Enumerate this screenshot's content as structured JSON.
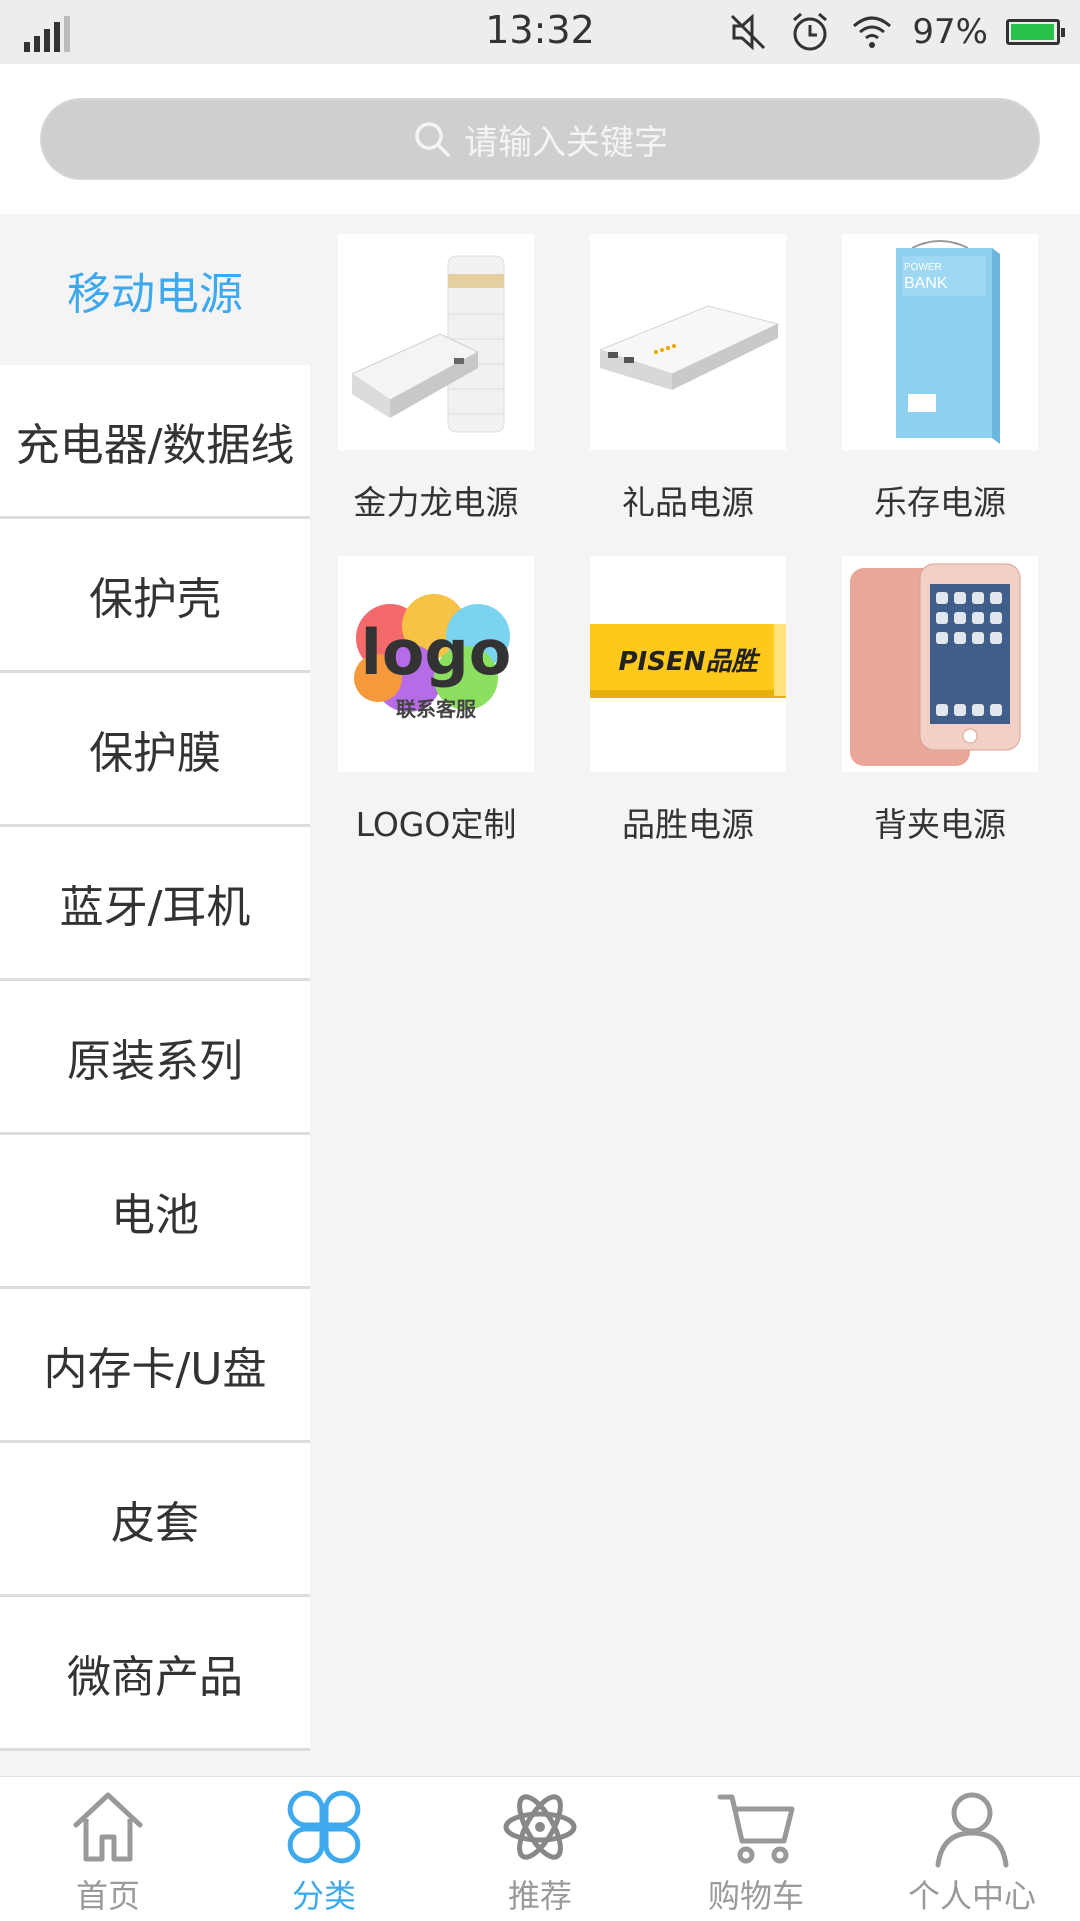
{
  "status_bar": {
    "time": "13:32",
    "battery_percent": "97%",
    "battery_level": 0.97,
    "icons": [
      "signal-icon",
      "mute-icon",
      "alarm-icon",
      "wifi-icon",
      "battery-icon"
    ]
  },
  "search": {
    "placeholder": "请输入关键字"
  },
  "sidebar": {
    "items": [
      {
        "label": "移动电源",
        "active": true
      },
      {
        "label": "充电器/数据线",
        "active": false
      },
      {
        "label": "保护壳",
        "active": false
      },
      {
        "label": "保护膜",
        "active": false
      },
      {
        "label": "蓝牙/耳机",
        "active": false
      },
      {
        "label": "原装系列",
        "active": false
      },
      {
        "label": "电池",
        "active": false
      },
      {
        "label": "内存卡/U盘",
        "active": false
      },
      {
        "label": "皮套",
        "active": false
      },
      {
        "label": "微商产品",
        "active": false
      }
    ]
  },
  "products": [
    {
      "name": "金力龙电源",
      "image": "white-striped-power-bank"
    },
    {
      "name": "礼品电源",
      "image": "white-rounded-power-bank"
    },
    {
      "name": "乐存电源",
      "image": "blue-power-bank-box"
    },
    {
      "name": "LOGO定制",
      "image": "colorful-logo-badge",
      "image_text": [
        "logo",
        "联系客服"
      ]
    },
    {
      "name": "品胜电源",
      "image": "pisen-yellow-power-bank",
      "image_text": [
        "PISEN品胜"
      ]
    },
    {
      "name": "背夹电源",
      "image": "rose-gold-phone-battery-case"
    }
  ],
  "tabbar": {
    "tabs": [
      {
        "label": "首页",
        "icon": "home-icon",
        "active": false
      },
      {
        "label": "分类",
        "icon": "category-icon",
        "active": true
      },
      {
        "label": "推荐",
        "icon": "atom-icon",
        "active": false
      },
      {
        "label": "购物车",
        "icon": "cart-icon",
        "active": false
      },
      {
        "label": "个人中心",
        "icon": "person-icon",
        "active": false
      }
    ]
  },
  "colors": {
    "accent": "#3fa9ee",
    "background": "#f4f4f4",
    "battery_green": "#29c24b"
  }
}
